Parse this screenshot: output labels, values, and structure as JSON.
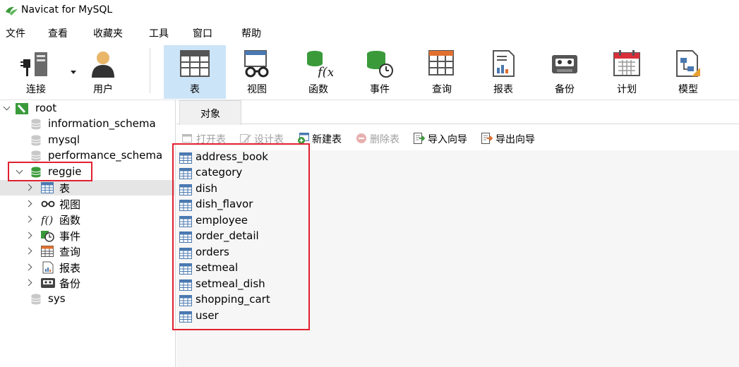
{
  "window": {
    "title": "Navicat for MySQL"
  },
  "menu": [
    "文件",
    "查看",
    "收藏夹",
    "工具",
    "窗口",
    "帮助"
  ],
  "toolbar": {
    "connect": "连接",
    "user": "用户",
    "table": "表",
    "view": "视图",
    "function": "函数",
    "event": "事件",
    "query": "查询",
    "report": "报表",
    "backup": "备份",
    "schedule": "计划",
    "model": "模型"
  },
  "tree": {
    "root": "root",
    "databases": [
      "information_schema",
      "mysql",
      "performance_schema",
      "reggie",
      "sys"
    ],
    "reggie_children": [
      "表",
      "视图",
      "函数",
      "事件",
      "查询",
      "报表",
      "备份"
    ]
  },
  "tab": {
    "objects": "对象"
  },
  "object_toolbar": {
    "open_table": "打开表",
    "design_table": "设计表",
    "new_table": "新建表",
    "delete_table": "删除表",
    "import_wizard": "导入向导",
    "export_wizard": "导出向导"
  },
  "tables": [
    "address_book",
    "category",
    "dish",
    "dish_flavor",
    "employee",
    "order_detail",
    "orders",
    "setmeal",
    "setmeal_dish",
    "shopping_cart",
    "user"
  ],
  "colors": {
    "highlight": "#e02030",
    "active_toolbar": "#cce4f7",
    "db_green": "#3a9a3a"
  }
}
